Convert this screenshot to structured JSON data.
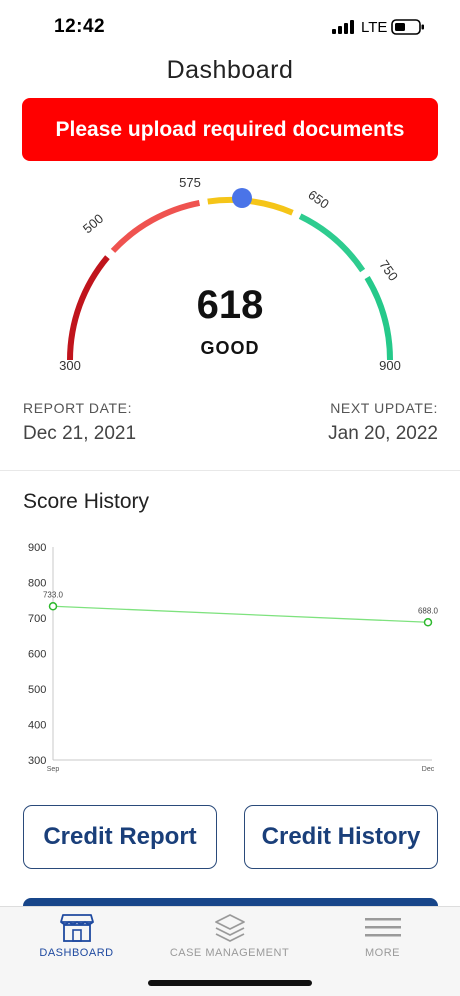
{
  "status_bar": {
    "time": "12:42",
    "network": "LTE"
  },
  "header": {
    "title": "Dashboard"
  },
  "alert": {
    "text": "Please upload required documents",
    "color": "#ff0000"
  },
  "gauge": {
    "score": "618",
    "rating": "GOOD",
    "min": 300,
    "max": 900,
    "tick_labels": [
      "300",
      "500",
      "575",
      "650",
      "750",
      "900"
    ],
    "segment_colors": [
      "#c0141c",
      "#ef5350",
      "#f5c518",
      "#2ecc8f",
      "#25c98a"
    ]
  },
  "report": {
    "report_date_label": "REPORT DATE:",
    "report_date": "Dec 21, 2021",
    "next_update_label": "NEXT UPDATE:",
    "next_update": "Jan 20, 2022"
  },
  "score_history": {
    "title": "Score History"
  },
  "chart_data": {
    "type": "line",
    "title": "",
    "x": [
      "Sep",
      "Dec"
    ],
    "series": [
      {
        "values": [
          733,
          688
        ],
        "point_labels": [
          "733.0",
          "688.0"
        ]
      }
    ],
    "ylim": [
      300,
      900
    ],
    "yticks": [
      "300",
      "400",
      "500",
      "600",
      "700",
      "800",
      "900"
    ],
    "grid": false,
    "line_color": "#7ee27e"
  },
  "actions": {
    "credit_report": "Credit Report",
    "credit_history": "Credit History"
  },
  "tab_bar": {
    "tabs": [
      {
        "label": "DASHBOARD",
        "icon": "store-icon",
        "active": true
      },
      {
        "label": "CASE MANAGEMENT",
        "icon": "layers-icon",
        "active": false
      },
      {
        "label": "MORE",
        "icon": "menu-icon",
        "active": false
      }
    ]
  }
}
